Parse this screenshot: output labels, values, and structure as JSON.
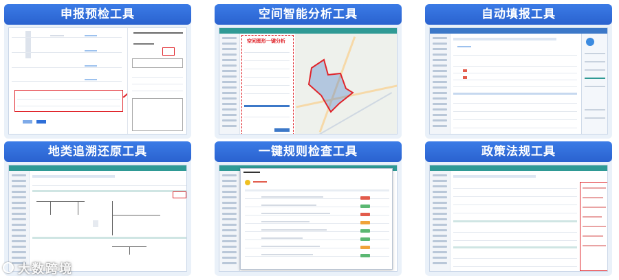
{
  "cards": [
    {
      "id": "declare-precheck",
      "title": "申报预检工具"
    },
    {
      "id": "spatial-analysis",
      "title": "空间智能分析工具",
      "overlay_label": "空间图形一键分析"
    },
    {
      "id": "auto-fill",
      "title": "自动填报工具"
    },
    {
      "id": "land-trace",
      "title": "地类追溯还原工具"
    },
    {
      "id": "rule-check",
      "title": "一键规则检查工具"
    },
    {
      "id": "policy",
      "title": "政策法规工具"
    }
  ],
  "watermark": {
    "text": "大数跨境"
  },
  "colors": {
    "title_bar": "#2f6fdb",
    "card_bg": "#eaf1f9",
    "highlight": "#e0242a"
  }
}
